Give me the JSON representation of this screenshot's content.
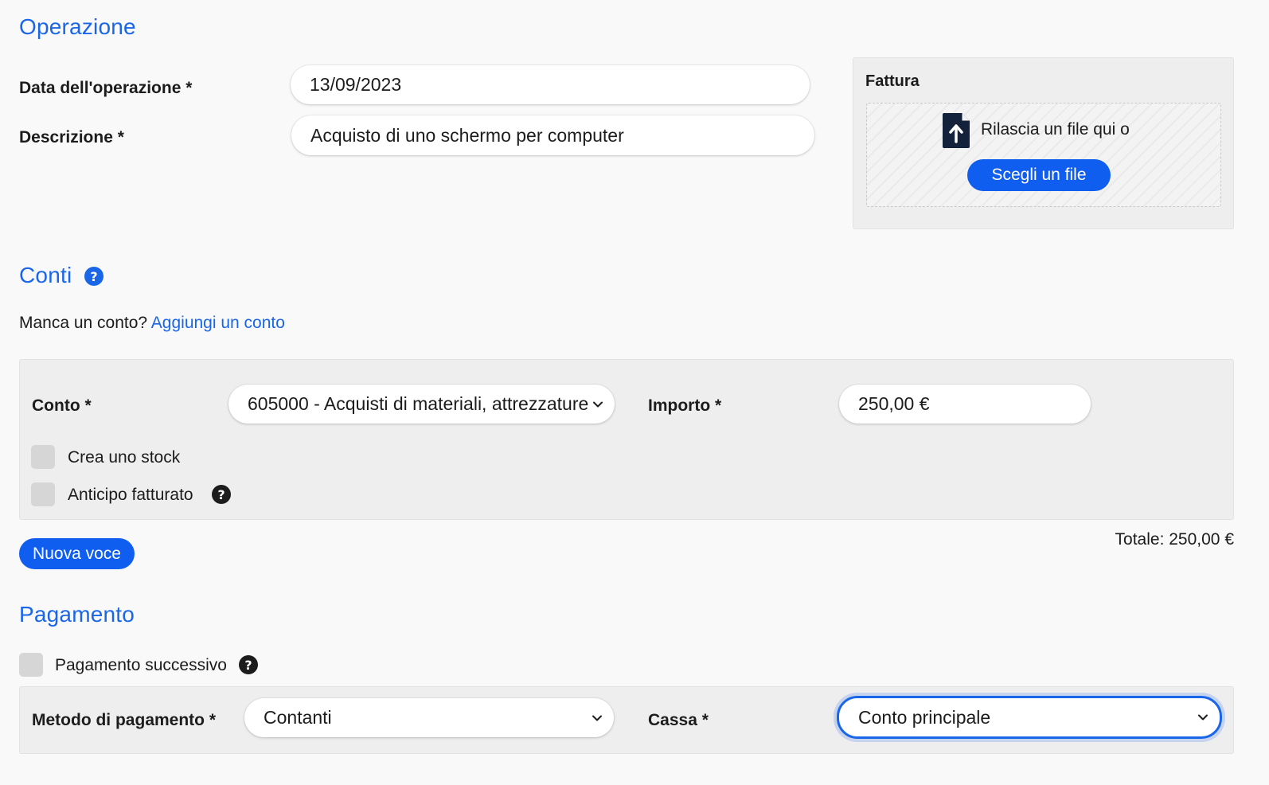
{
  "sections": {
    "operation_title": "Operazione",
    "accounts_title": "Conti",
    "payment_title": "Pagamento"
  },
  "operation": {
    "date_label": "Data dell'operazione *",
    "date_value": "13/09/2023",
    "description_label": "Descrizione *",
    "description_value": "Acquisto di uno schermo per computer"
  },
  "invoice": {
    "title": "Fattura",
    "drop_text": "Rilascia un file qui o",
    "choose_button": "Scegli un file"
  },
  "accounts": {
    "missing_text": "Manca un conto?",
    "add_link": "Aggiungi un conto",
    "account_label": "Conto *",
    "account_value": "605000 - Acquisti di materiali, attrezzature",
    "amount_label": "Importo *",
    "amount_value": "250,00 €",
    "create_stock_label": "Crea uno stock",
    "advance_label": "Anticipo fatturato",
    "new_entry_button": "Nuova voce",
    "total_text": "Totale: 250,00 €"
  },
  "payment": {
    "later_label": "Pagamento successivo",
    "method_label": "Metodo di pagamento *",
    "method_value": "Contanti",
    "cash_label": "Cassa *",
    "cash_value": "Conto principale"
  },
  "colors": {
    "accent": "#1a66e8",
    "button": "#0f5ef0",
    "panel": "#eeeeee"
  }
}
